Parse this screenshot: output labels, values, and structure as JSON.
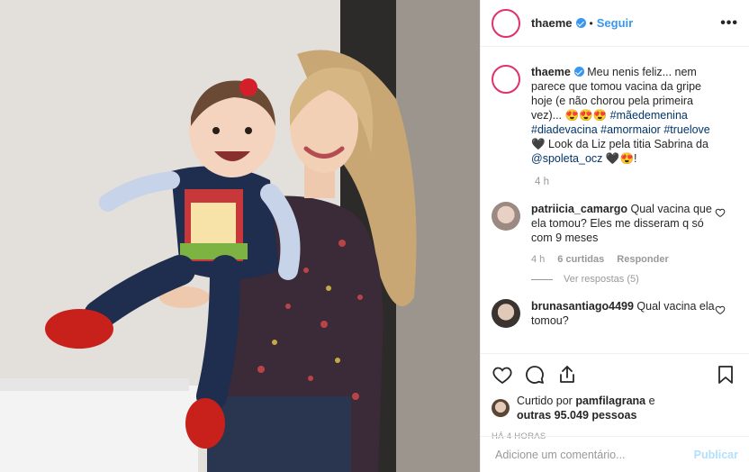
{
  "post": {
    "username": "thaeme",
    "follow_label": "Seguir",
    "separator": "•",
    "more_label": "•••",
    "caption": {
      "line1": "Meu nenis feliz... nem",
      "line2": "parece que tomou vacina da gripe",
      "line3": "hoje (e não chorou pela primeira",
      "line4": "vez)... 😍😍😍 ",
      "tag1": "#mãedemenina",
      "tag2": "#diadevacina",
      "tag3": "#amormaior",
      "tag4": "#truelove",
      "line5": "🖤 Look da Liz pela titia Sabrina da",
      "mention": "@spoleta_ocz",
      "line6_end": " 🖤😍!"
    },
    "caption_time": "4 h"
  },
  "comments": [
    {
      "username": "patriicia_camargo",
      "text": "Qual vacina que ela tomou? Eles me disseram q só com 9 meses",
      "time": "4 h",
      "likes": "6 curtidas",
      "reply_label": "Responder",
      "view_replies": "Ver respostas (5)"
    },
    {
      "username": "brunasantiago4499",
      "text": "Qual vacina ela tomou?"
    }
  ],
  "likes": {
    "prefix": "Curtido por",
    "user": "pamfilagrana",
    "and": "e",
    "others": "outras 95.049 pessoas"
  },
  "posted_ago": "HÁ 4 HORAS",
  "add_comment": {
    "placeholder": "Adicione um comentário...",
    "post_label": "Publicar"
  },
  "colors": {
    "link": "#3897f0",
    "hashtag": "#003569",
    "muted": "#999999",
    "publish_disabled": "#b2dffc"
  }
}
